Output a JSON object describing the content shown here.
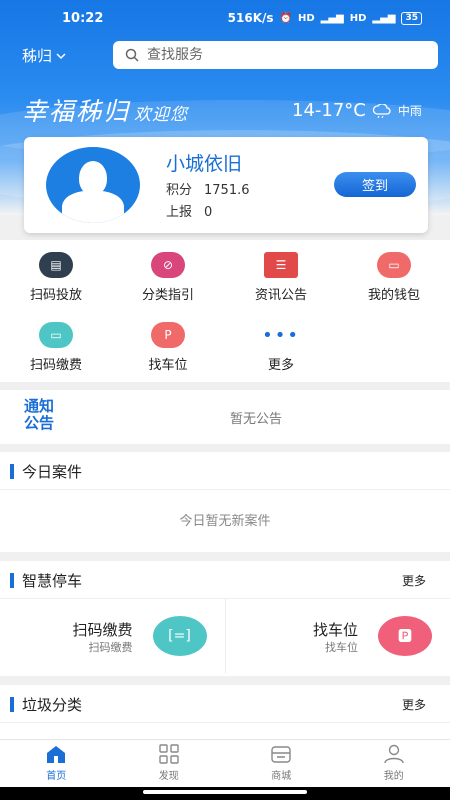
{
  "status": {
    "time": "10:22",
    "speed": "516K/s",
    "battery": "35"
  },
  "header": {
    "city": "秭归",
    "search_placeholder": "查找服务",
    "slogan": "幸福秭归",
    "welcome": "欢迎您",
    "temperature": "14-17°C",
    "weather": "中雨"
  },
  "profile": {
    "name": "小城依旧",
    "points_label": "积分",
    "points_value": "1751.6",
    "reports_label": "上报",
    "reports_value": "0",
    "signin_label": "签到"
  },
  "services": [
    {
      "label": "扫码投放",
      "icon": "scan-drop-icon"
    },
    {
      "label": "分类指引",
      "icon": "compass-icon"
    },
    {
      "label": "资讯公告",
      "icon": "news-icon"
    },
    {
      "label": "我的钱包",
      "icon": "wallet-icon"
    },
    {
      "label": "扫码缴费",
      "icon": "scan-pay-icon"
    },
    {
      "label": "找车位",
      "icon": "parking-icon"
    },
    {
      "label": "更多",
      "icon": "more-dots-icon"
    }
  ],
  "notice": {
    "title": "通知公告",
    "text": "暂无公告"
  },
  "cases": {
    "title": "今日案件",
    "empty": "今日暂无新案件"
  },
  "parking": {
    "title": "智慧停车",
    "more": "更多",
    "items": [
      {
        "name": "扫码缴费",
        "sub": "扫码缴费"
      },
      {
        "name": "找车位",
        "sub": "找车位"
      }
    ]
  },
  "garbage": {
    "title": "垃圾分类",
    "more": "更多"
  },
  "tabs": [
    {
      "label": "首页"
    },
    {
      "label": "发现"
    },
    {
      "label": "商城"
    },
    {
      "label": "我的"
    }
  ],
  "colors": {
    "accent": "#1a6fd6"
  }
}
